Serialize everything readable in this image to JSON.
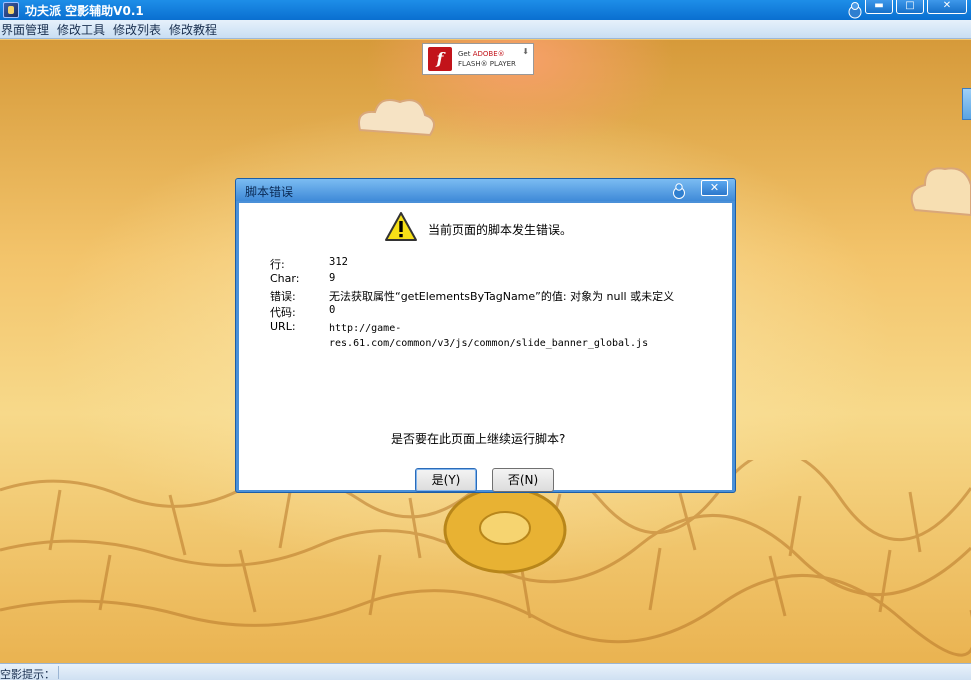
{
  "window": {
    "title": "功夫派 空影辅助V0.1",
    "controls": {
      "minimize": "▬",
      "maximize": "□",
      "close": "✕"
    }
  },
  "menu": {
    "items": [
      "界面管理",
      "修改工具",
      "修改列表",
      "修改教程"
    ]
  },
  "flash_badge": {
    "get": "Get",
    "brand": "ADOBE®",
    "product": "FLASH® PLAYER",
    "logo_letter": "f"
  },
  "dialog": {
    "title": "脚本错误",
    "close_label": "✕",
    "headline": "当前页面的脚本发生错误。",
    "fields": {
      "line_label": "行:",
      "line_value": "312",
      "char_label": "Char:",
      "char_value": "9",
      "error_label": "错误:",
      "error_value": "无法获取属性“getElementsByTagName”的值: 对象为 null 或未定义",
      "code_label": "代码:",
      "code_value": "0",
      "url_label": "URL:",
      "url_value": "http://game-\nres.61.com/common/v3/js/common/slide_banner_global.js"
    },
    "question": "是否要在此页面上继续运行脚本?",
    "buttons": {
      "yes": "是(Y)",
      "no": "否(N)"
    }
  },
  "statusbar": {
    "label": "空影提示："
  },
  "colors": {
    "titlebar": "#0a6fd0",
    "dialog_frame": "#4a90d8",
    "warning_yellow": "#f7e017"
  }
}
